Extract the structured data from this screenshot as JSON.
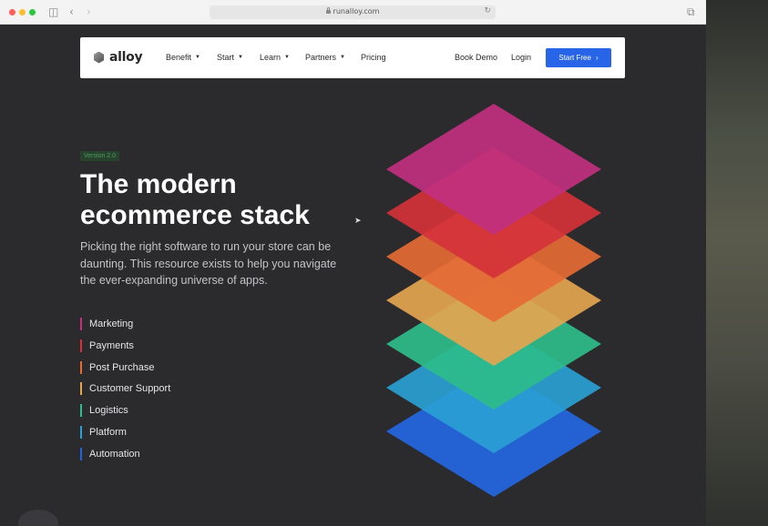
{
  "browser": {
    "url": "runalloy.com",
    "sidebar_icon": "sidebar-icon",
    "back_icon": "chevron-left-icon",
    "forward_icon": "chevron-right-icon",
    "reload_icon": "reload-icon",
    "tabs_icon": "tabs-overview-icon",
    "traffic_lights": [
      "#ff5f57",
      "#febc2e",
      "#28c840"
    ]
  },
  "nav": {
    "logo_text": "alloy",
    "items": [
      {
        "label": "Benefit",
        "dropdown": true
      },
      {
        "label": "Start",
        "dropdown": true
      },
      {
        "label": "Learn",
        "dropdown": true
      },
      {
        "label": "Partners",
        "dropdown": true
      },
      {
        "label": "Pricing",
        "dropdown": false
      }
    ],
    "book_demo": "Book Demo",
    "login": "Login",
    "start_free": "Start Free",
    "start_free_icon": "chevron-right-icon",
    "accent": "#2764e8"
  },
  "hero": {
    "badge": "Version 2.0",
    "title_line1": "The modern",
    "title_line2": "ecommerce stack",
    "description": "Picking the right software to run your store can be daunting. This resource exists to help you navigate the ever-expanding universe of apps."
  },
  "categories": [
    {
      "label": "Marketing",
      "color": "#c0307f"
    },
    {
      "label": "Payments",
      "color": "#d4323a"
    },
    {
      "label": "Post Purchase",
      "color": "#e56a35"
    },
    {
      "label": "Customer Support",
      "color": "#e4a550"
    },
    {
      "label": "Logistics",
      "color": "#2ebc8a"
    },
    {
      "label": "Platform",
      "color": "#2a9fd2"
    },
    {
      "label": "Automation",
      "color": "#2463d8"
    }
  ],
  "stack_layers": [
    "#2463d8",
    "#2a9fd2",
    "#2ebc8a",
    "#e4a550",
    "#e56a35",
    "#d4323a",
    "#c0307f"
  ]
}
